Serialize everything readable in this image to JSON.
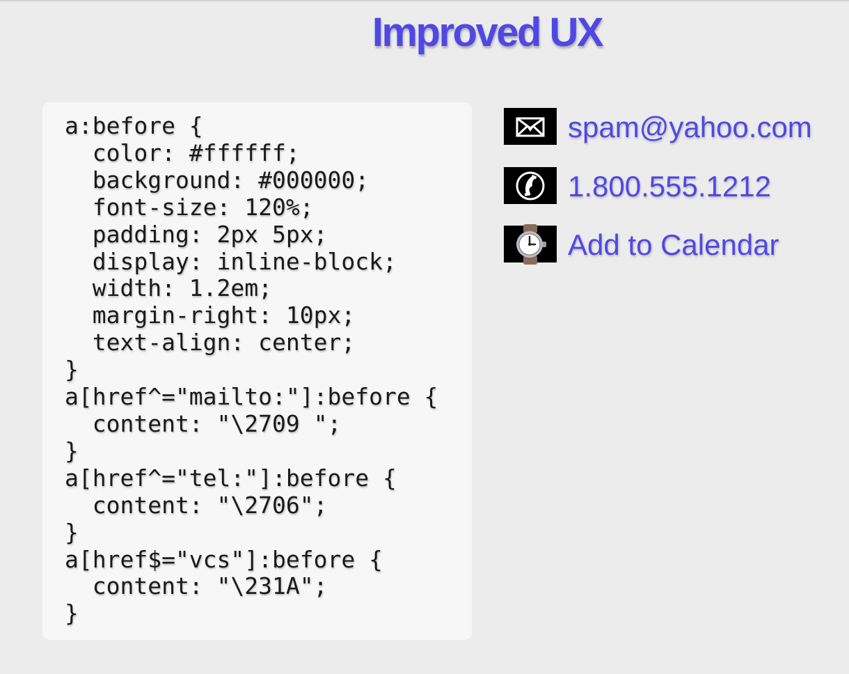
{
  "page": {
    "title": "Improved UX"
  },
  "code": {
    "lines": [
      "a:before {",
      "  color: #ffffff;",
      "  background: #000000;",
      "  font-size: 120%;",
      "  padding: 2px 5px;",
      "  display: inline-block;",
      "  width: 1.2em;",
      "  margin-right: 10px;",
      "  text-align: center;",
      "}",
      "a[href^=\"mailto:\"]:before {",
      "  content: \"\\2709 \";",
      "}",
      "a[href^=\"tel:\"]:before {",
      "  content: \"\\2706\";",
      "}",
      "a[href$=\"vcs\"]:before {",
      "  content: \"\\231A\";",
      "}"
    ]
  },
  "links": {
    "email": {
      "label": "spam@yahoo.com",
      "icon": "envelope-icon"
    },
    "phone": {
      "label": "1.800.555.1212",
      "icon": "telephone-icon"
    },
    "calendar": {
      "label": "Add to Calendar",
      "icon": "watch-icon"
    }
  },
  "colors": {
    "accent": "#5048e5",
    "background": "#ececec",
    "panel": "#f7f7f7",
    "badge": "#000000"
  }
}
